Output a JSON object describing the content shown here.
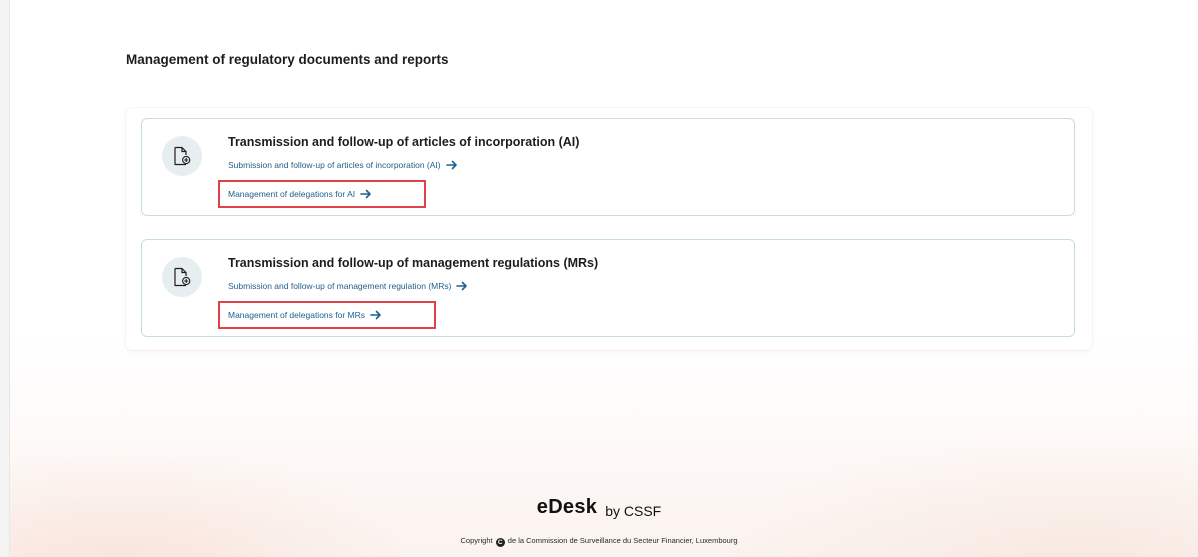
{
  "section": {
    "title": "Management of regulatory documents and reports"
  },
  "cards": [
    {
      "title": "Transmission and follow-up of articles of incorporation (AI)",
      "links": [
        {
          "label": "Submission and follow-up of articles of incorporation (AI)"
        },
        {
          "label": "Management of delegations for AI"
        }
      ]
    },
    {
      "title": "Transmission and follow-up of management regulations (MRs)",
      "links": [
        {
          "label": "Submission and follow-up of management regulation (MRs)"
        },
        {
          "label": "Management of delegations for MRs"
        }
      ]
    }
  ],
  "footer": {
    "brand": "eDesk",
    "brand_suffix": "by CSSF",
    "copyright_prefix": "Copyright",
    "copyright_symbol": "C",
    "copyright_text": "de la Commission de Surveillance du Secteur Financier, Luxembourg"
  },
  "colors": {
    "link": "#1f5f8b",
    "card_border": "#c8dde3",
    "icon_bg": "#e7eef0",
    "highlight": "#e0424a"
  },
  "icons": {
    "card": "document-add-icon",
    "link": "arrow-right-icon"
  }
}
